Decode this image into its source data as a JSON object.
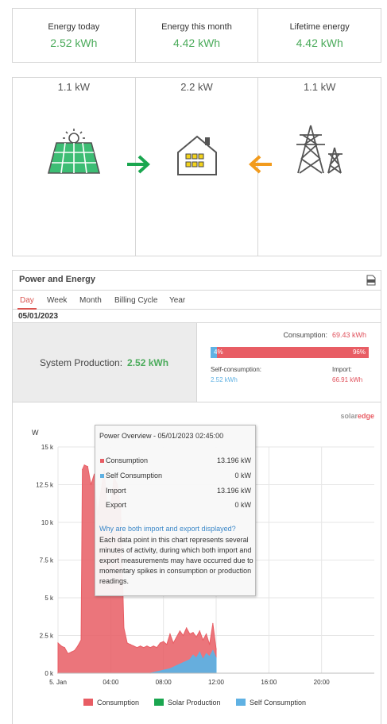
{
  "stats": [
    {
      "label": "Energy today",
      "value": "2.52 kWh"
    },
    {
      "label": "Energy this month",
      "value": "4.42 kWh"
    },
    {
      "label": "Lifetime energy",
      "value": "4.42 kWh"
    }
  ],
  "flow": {
    "solar_kw": "1.1 kW",
    "home_kw": "2.2 kW",
    "grid_kw": "1.1 kW",
    "colors": {
      "solar_arrow": "#1aa64f",
      "grid_arrow": "#f29b1d",
      "panel": "#3dbd74"
    }
  },
  "panel": {
    "title": "Power and Energy",
    "csv_icon": "csv-export-icon",
    "tabs": [
      "Day",
      "Week",
      "Month",
      "Billing Cycle",
      "Year"
    ],
    "active_tab": "Day",
    "date": "05/01/2023"
  },
  "summary": {
    "system_production_label": "System Production:",
    "system_production_value": "2.52 kWh",
    "consumption_label": "Consumption:",
    "consumption_value": "69.43 kWh",
    "self_pct": "4%",
    "import_pct": "96%",
    "self_fraction": 0.04,
    "self_consumption_label": "Self-consumption:",
    "self_consumption_value": "2.52 kWh",
    "import_label": "Import:",
    "import_value": "66.91 kWh"
  },
  "brand": {
    "text1": "solar",
    "text2": "edge"
  },
  "tooltip": {
    "title": "Power Overview - 05/01/2023 02:45:00",
    "rows": [
      {
        "name": "Consumption",
        "value": "13.196 kW"
      },
      {
        "name": "Self Consumption",
        "value": "0 kW"
      },
      {
        "name": "Import",
        "value": "13.196 kW"
      },
      {
        "name": "Export",
        "value": "0 kW"
      }
    ],
    "link": "Why are both import and export displayed?",
    "text": "Each data point in this chart represents several minutes of activity, during which both import and export measurements may have occurred due to momentary spikes in consumption or production readings."
  },
  "chart_data": {
    "type": "area",
    "ylabel": "W",
    "y_ticks": [
      "0 k",
      "2.5 k",
      "5 k",
      "7.5 k",
      "10 k",
      "12.5 k",
      "15 k"
    ],
    "ylim": [
      0,
      15000
    ],
    "x_ticks": [
      "5. Jan",
      "04:00",
      "08:00",
      "12:00",
      "16:00",
      "20:00"
    ],
    "x_tick_hours": [
      0,
      4,
      8,
      12,
      16,
      20
    ],
    "xlim": [
      0,
      24
    ],
    "series": [
      {
        "name": "Consumption",
        "color": "#e85d64",
        "x": [
          0,
          0.25,
          0.5,
          0.75,
          1.0,
          1.25,
          1.5,
          1.75,
          1.85,
          2.0,
          2.25,
          2.5,
          2.75,
          3.0,
          3.25,
          3.5,
          3.75,
          4.0,
          4.25,
          4.5,
          4.75,
          5.0,
          5.25,
          5.5,
          5.75,
          6.0,
          6.25,
          6.5,
          6.75,
          7.0,
          7.25,
          7.5,
          7.75,
          8.0,
          8.25,
          8.5,
          8.75,
          9.0,
          9.25,
          9.5,
          9.75,
          10.0,
          10.25,
          10.5,
          10.75,
          11.0,
          11.25,
          11.5,
          11.75,
          12.0
        ],
        "y": [
          2000,
          1800,
          1700,
          1300,
          1400,
          1500,
          1800,
          2200,
          13500,
          13800,
          13700,
          12500,
          13196,
          10500,
          12000,
          13500,
          10800,
          11000,
          13000,
          12500,
          11000,
          3000,
          2000,
          1900,
          1800,
          1700,
          1800,
          1700,
          1800,
          1700,
          1800,
          1700,
          2000,
          2100,
          1900,
          2600,
          2000,
          2400,
          2800,
          2500,
          3000,
          2600,
          2700,
          2400,
          2800,
          2200,
          2600,
          1900,
          3300,
          1600
        ]
      },
      {
        "name": "Solar Production",
        "color": "#1aa64f",
        "x": [],
        "y": []
      },
      {
        "name": "Self Consumption",
        "color": "#5fb1e3",
        "x": [
          7.0,
          7.5,
          8.0,
          8.5,
          9.0,
          9.5,
          10.0,
          10.25,
          10.5,
          10.75,
          11.0,
          11.25,
          11.5,
          11.75,
          12.0
        ],
        "y": [
          0,
          100,
          200,
          300,
          500,
          700,
          900,
          1200,
          1000,
          1400,
          900,
          1300,
          1100,
          1500,
          1000
        ]
      }
    ],
    "grid": true,
    "legend": "bottom"
  }
}
